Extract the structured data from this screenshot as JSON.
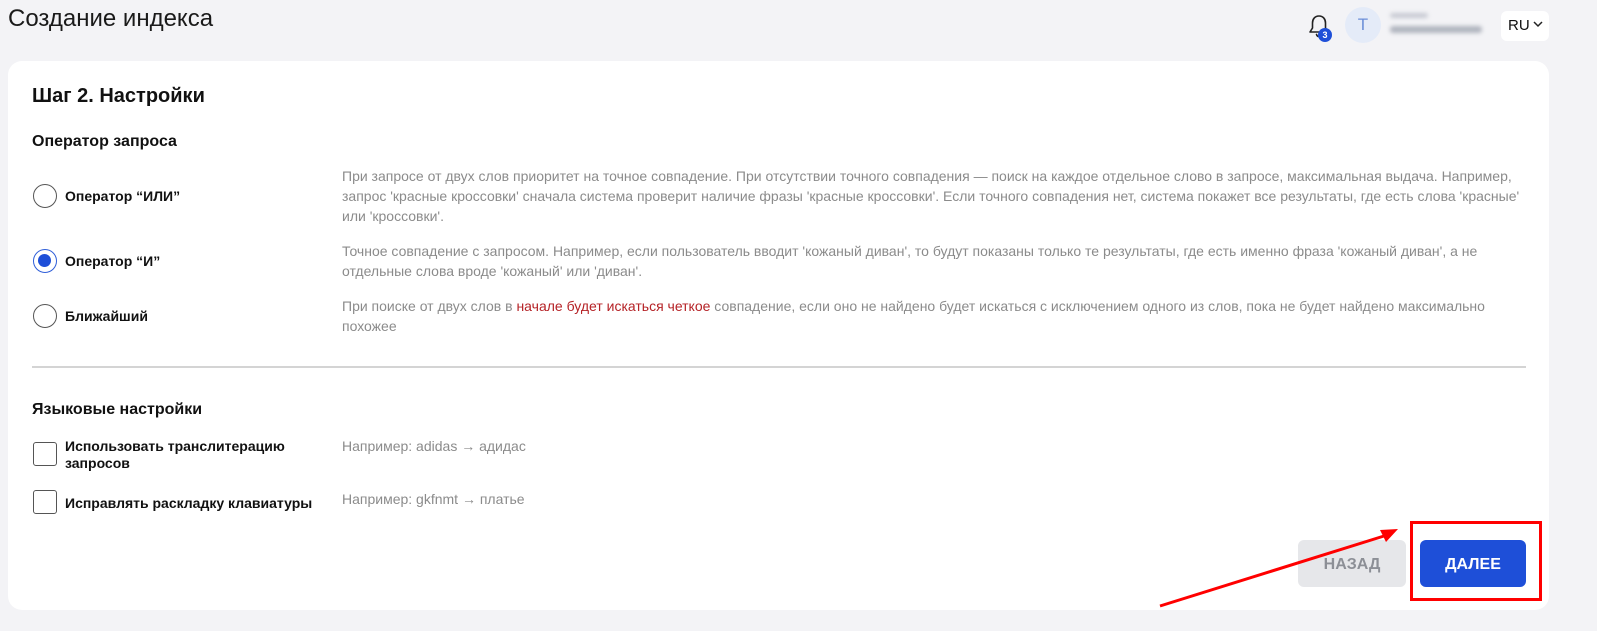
{
  "page_title": "Создание индекса",
  "header": {
    "notifications_count": "3",
    "avatar_initial": "T",
    "language": "RU"
  },
  "card": {
    "step_title": "Шаг 2. Настройки",
    "query_operator": {
      "title": "Оператор запроса",
      "options": [
        {
          "label": "Оператор “ИЛИ”",
          "selected": false,
          "description": "При запросе от двух слов приоритет на точное совпадение. При отсутствии точного совпадения — поиск на каждое отдельное слово в запросе,  максимальная выдача. Например, запрос 'красные кроссовки' сначала система проверит наличие фразы 'красные кроссовки'. Если точного совпадения нет, система покажет все результаты, где есть слова 'красные' или 'кроссовки'."
        },
        {
          "label": "Оператор “И”",
          "selected": true,
          "description": "Точное совпадение с запросом. Например, если пользователь вводит 'кожаный диван', то будут показаны только те результаты, где есть именно фраза 'кожаный диван', а не отдельные слова вроде 'кожаный' или 'диван'."
        },
        {
          "label": "Ближайший",
          "selected": false,
          "description_before": "При поиске от двух слов в ",
          "description_highlight": "начале будет искаться четкое",
          "description_after": " совпадение, если оно не найдено будет искаться с исключением одного из слов, пока не будет найдено максимально похожее"
        }
      ]
    },
    "language_settings": {
      "title": "Языковые настройки",
      "options": [
        {
          "label": "Использовать транслитерацию запросов",
          "checked": false,
          "example": "Например: adidas → адидас"
        },
        {
          "label": "Исправлять раскладку клавиатуры",
          "checked": false,
          "example": "Например: gkfnmt → платье"
        }
      ]
    },
    "buttons": {
      "back": "НАЗАД",
      "next": "ДАЛЕЕ"
    }
  },
  "colors": {
    "accent": "#1e4fd8",
    "annotation": "#ff0000",
    "highlight_text": "#b52226"
  }
}
